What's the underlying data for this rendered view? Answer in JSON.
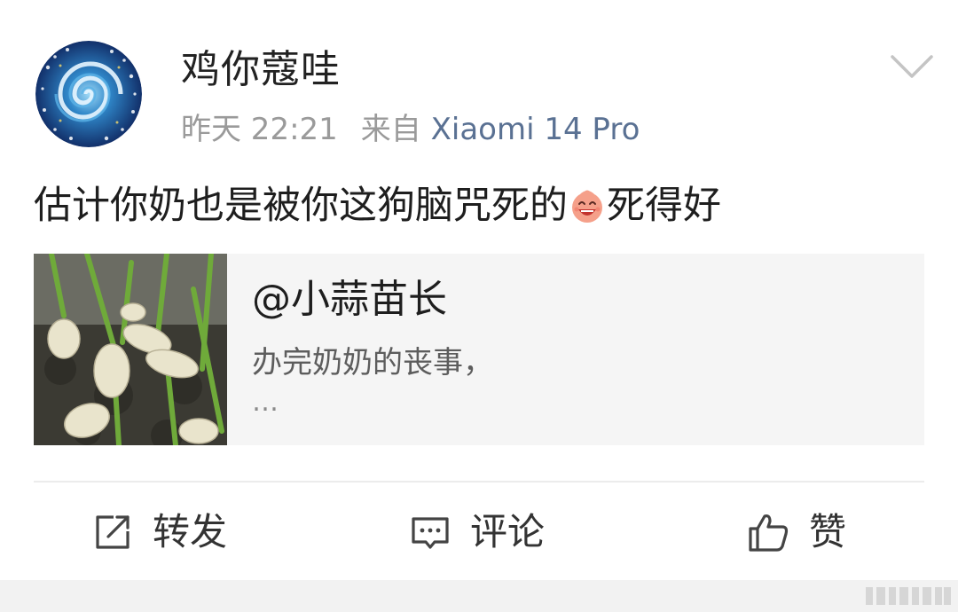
{
  "post": {
    "username": "鸡你蔻哇",
    "time": "昨天 22:21",
    "source_prefix": "来自",
    "source_device": "Xiaomi 14 Pro",
    "text_before_emoji": "估计你奶也是被你这狗脑咒死的",
    "emoji_icon": "laughing-face-emoji",
    "text_after_emoji": "死得好"
  },
  "quoted_card": {
    "title": "@小蒜苗长",
    "description": "办完奶奶的丧事，",
    "ellipsis": "…"
  },
  "actions": {
    "repost_label": "转发",
    "comment_label": "评论",
    "like_label": "赞"
  },
  "colors": {
    "device_link": "#5a7193",
    "meta_gray": "#9a9a9a",
    "card_background": "#f5f5f5"
  }
}
